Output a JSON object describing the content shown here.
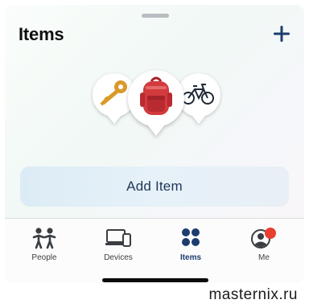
{
  "header": {
    "title": "Items",
    "add_icon": "plus-icon"
  },
  "items_preview": {
    "pins": [
      {
        "name": "key",
        "icon": "key-icon"
      },
      {
        "name": "backpack",
        "icon": "backpack-icon"
      },
      {
        "name": "bicycle",
        "icon": "bicycle-icon"
      }
    ]
  },
  "add_item": {
    "label": "Add Item"
  },
  "tabbar": {
    "tabs": [
      {
        "label": "People",
        "icon": "people-icon"
      },
      {
        "label": "Devices",
        "icon": "devices-icon"
      },
      {
        "label": "Items",
        "icon": "items-grid-icon",
        "active": true
      },
      {
        "label": "Me",
        "icon": "person-circle-icon",
        "badge_color": "#ea3f2e"
      }
    ]
  },
  "colors": {
    "accent": "#1d3d6e",
    "badge": "#ea3f2e"
  },
  "watermark": "masternix.ru"
}
